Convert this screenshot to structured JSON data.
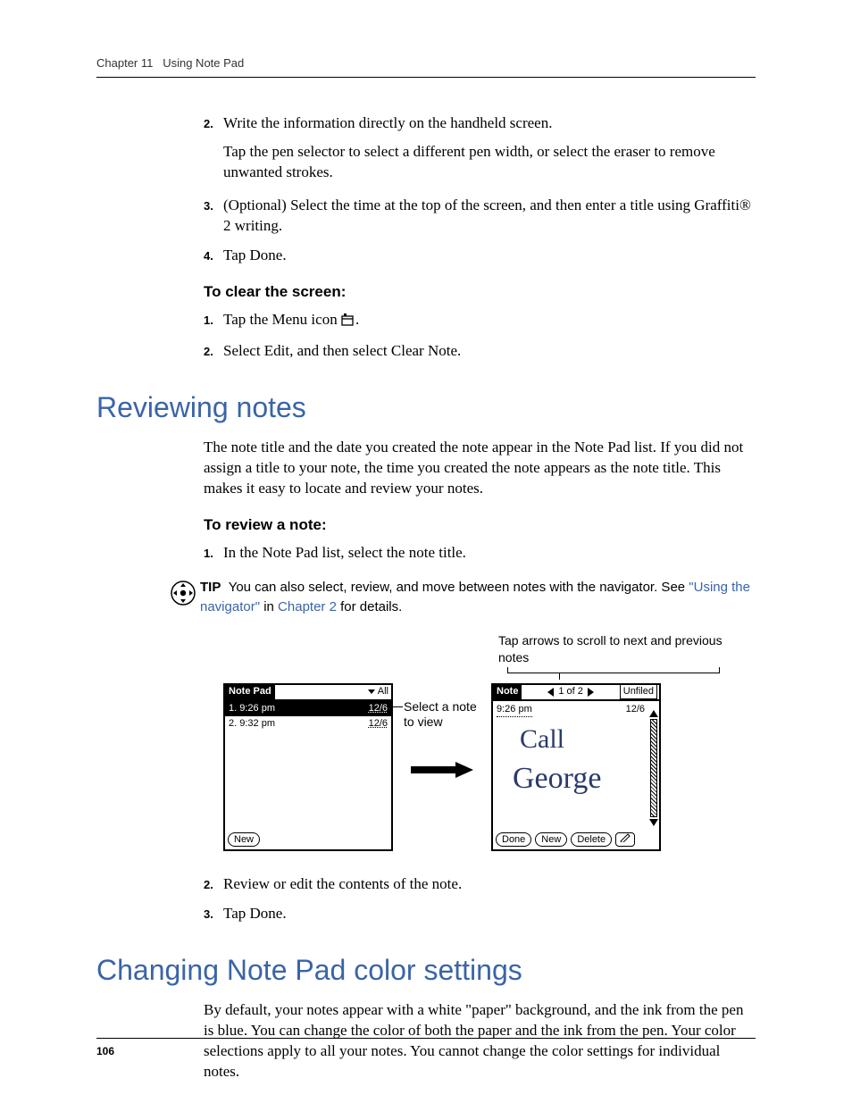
{
  "header": {
    "chapter": "Chapter 11",
    "title": "Using Note Pad"
  },
  "steps_top": {
    "s2": {
      "num": "2.",
      "text": "Write the information directly on the handheld screen."
    },
    "s2_sub": "Tap the pen selector to select a different pen width, or select the eraser to remove unwanted strokes.",
    "s3": {
      "num": "3.",
      "text_a": "(Optional) Select the time at the top of the screen, and then enter a title using Graffiti",
      "reg": "®",
      "text_b": " 2 writing."
    },
    "s4": {
      "num": "4.",
      "text": "Tap Done."
    }
  },
  "clear": {
    "heading": "To clear the screen:",
    "s1": {
      "num": "1.",
      "text_a": "Tap the Menu icon ",
      "text_b": "."
    },
    "s2": {
      "num": "2.",
      "text": "Select Edit, and then select Clear Note."
    }
  },
  "section_review": {
    "heading": "Reviewing notes",
    "para": "The note title and the date you created the note appear in the Note Pad list. If you did not assign a title to your note, the time you created the note appears as the note title. This makes it easy to locate and review your notes.",
    "proc_heading": "To review a note:",
    "s1": {
      "num": "1.",
      "text": "In the Note Pad list, select the note title."
    },
    "tip_label": "TIP",
    "tip_text_a": "You can also select, review, and move between notes with the navigator. See ",
    "tip_link1": "\"Using the navigator\"",
    "tip_mid": " in ",
    "tip_link2": "Chapter 2",
    "tip_text_b": " for details.",
    "caption_top": "Tap arrows to scroll to next and previous notes",
    "mid_label": "Select a note to view",
    "list_screen": {
      "title": "Note Pad",
      "category": "All",
      "rows": [
        {
          "idx": "1.",
          "label": "9:26 pm",
          "date": "12/6",
          "selected": true
        },
        {
          "idx": "2.",
          "label": "9:32 pm",
          "date": "12/6",
          "selected": false
        }
      ],
      "new_btn": "New"
    },
    "note_screen": {
      "title": "Note",
      "counter": "1 of 2",
      "category": "Unfiled",
      "time": "9:26 pm",
      "date": "12/6",
      "hand1": "Call",
      "hand2": "George",
      "done_btn": "Done",
      "new_btn": "New",
      "delete_btn": "Delete"
    },
    "s2": {
      "num": "2.",
      "text": "Review or edit the contents of the note."
    },
    "s3": {
      "num": "3.",
      "text": "Tap Done."
    }
  },
  "section_color": {
    "heading": "Changing Note Pad color settings",
    "para": "By default, your notes appear with a white \"paper\" background, and the ink from the pen is blue. You can change the color of both the paper and the ink from the pen. Your color selections apply to all your notes. You cannot change the color settings for individual notes."
  },
  "footer": {
    "page": "106"
  }
}
